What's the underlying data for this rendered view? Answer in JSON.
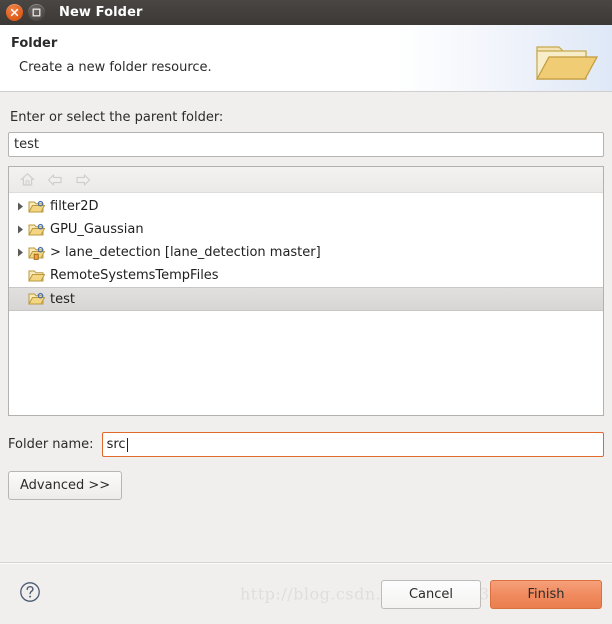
{
  "window": {
    "title": "New Folder",
    "close_icon": "close-icon",
    "maximize_icon": "maximize-icon"
  },
  "banner": {
    "title": "Folder",
    "description": "Create a new folder resource.",
    "icon": "folder-large-icon"
  },
  "parent_folder": {
    "label": "Enter or select the parent folder:",
    "value": "test",
    "placeholder": ""
  },
  "tree": {
    "toolbar": [
      {
        "name": "home-icon",
        "label": "Home",
        "enabled": false
      },
      {
        "name": "back-arrow-icon",
        "label": "Back",
        "enabled": false
      },
      {
        "name": "forward-arrow-icon",
        "label": "Forward",
        "enabled": false
      }
    ],
    "rows": [
      {
        "label": "filter2D",
        "expandable": true,
        "selected": false,
        "icon": "folder-icon",
        "decorated": false
      },
      {
        "label": "GPU_Gaussian",
        "expandable": true,
        "selected": false,
        "icon": "folder-icon",
        "decorated": false
      },
      {
        "label": "> lane_detection  [lane_detection master]",
        "expandable": true,
        "selected": false,
        "icon": "folder-icon",
        "decorated": true
      },
      {
        "label": "RemoteSystemsTempFiles",
        "expandable": false,
        "selected": false,
        "icon": "folder-plain-icon",
        "decorated": false
      },
      {
        "label": "test",
        "expandable": false,
        "selected": true,
        "icon": "folder-icon",
        "decorated": false
      }
    ]
  },
  "folder_name": {
    "label": "Folder name:",
    "value": "src",
    "placeholder": ""
  },
  "advanced": {
    "label": "Advanced >>"
  },
  "footer": {
    "help_icon": "help-icon",
    "watermark": "http://blog.csdn.net/weixin_36840947",
    "cancel_label": "Cancel",
    "finish_label": "Finish"
  },
  "colors": {
    "titlebar": "#3c3835",
    "close_button": "#e2601c",
    "finish_button": "#ef8a5e",
    "focus_border": "#e06a2b",
    "dialog_background": "#f0efee"
  }
}
